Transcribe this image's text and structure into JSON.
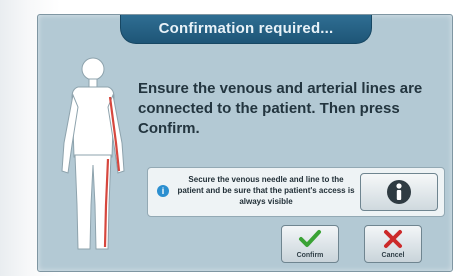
{
  "dialog": {
    "title": "Confirmation required...",
    "message": "Ensure the venous and arterial lines are connected to the patient.  Then press Confirm.",
    "info": {
      "icon": "info-icon",
      "text": "Secure the venous needle and line to the patient and be sure that the patient's access is always visible",
      "button_icon": "info-person-icon"
    },
    "buttons": {
      "confirm_label": "Confirm",
      "confirm_icon": "checkmark-icon",
      "cancel_label": "Cancel",
      "cancel_icon": "x-icon"
    }
  },
  "colors": {
    "dialog_background": "#b3c9d4",
    "title_bar": "#2f6e93",
    "venous_line": "#d6473e",
    "confirm_check": "#3aa335",
    "cancel_x": "#cc2a2a"
  }
}
